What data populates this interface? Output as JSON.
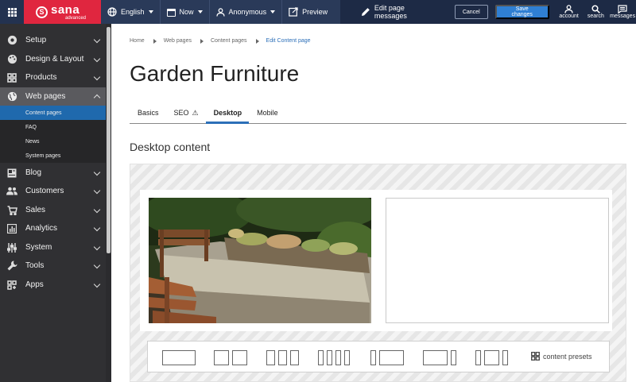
{
  "topbar": {
    "logo_name": "sana",
    "logo_sub": "advanced",
    "language": "English",
    "date": "Now",
    "user": "Anonymous",
    "preview": "Preview",
    "edit_messages": "Edit page messages",
    "cancel": "Cancel",
    "save": "Save changes",
    "account": "account",
    "search": "search",
    "messages": "messages"
  },
  "sidebar": {
    "items": [
      {
        "label": "Setup",
        "icon": "gear-icon"
      },
      {
        "label": "Design & Layout",
        "icon": "palette-icon"
      },
      {
        "label": "Products",
        "icon": "products-grid-icon"
      },
      {
        "label": "Web pages",
        "icon": "globe-icon"
      },
      {
        "label": "Blog",
        "icon": "blog-icon"
      },
      {
        "label": "Customers",
        "icon": "customers-icon"
      },
      {
        "label": "Sales",
        "icon": "cart-icon"
      },
      {
        "label": "Analytics",
        "icon": "analytics-icon"
      },
      {
        "label": "System",
        "icon": "system-icon"
      },
      {
        "label": "Tools",
        "icon": "wrench-icon"
      },
      {
        "label": "Apps",
        "icon": "apps-icon"
      }
    ],
    "subitems": [
      "Content pages",
      "FAQ",
      "News",
      "System pages"
    ]
  },
  "breadcrumb": [
    "Home",
    "Web pages",
    "Content pages",
    "Edit Content page"
  ],
  "page": {
    "title": "Garden Furniture",
    "section_title": "Desktop content",
    "presets_label": "content presets"
  },
  "tabs": [
    "Basics",
    "SEO",
    "Desktop",
    "Mobile"
  ],
  "colors": {
    "topbar": "#2a3a59",
    "logo": "#e0263f",
    "active_subitem": "#1f69ad",
    "save_button": "#2f7fd3",
    "sidebar": "#303033"
  }
}
